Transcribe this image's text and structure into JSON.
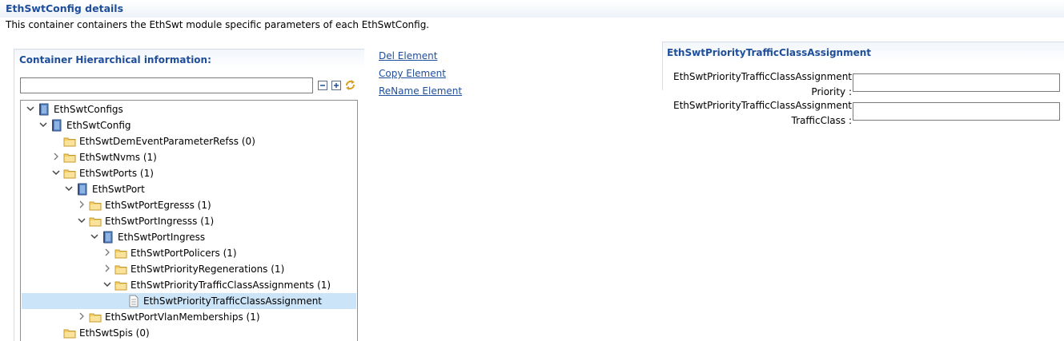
{
  "header": {
    "title": "EthSwtConfig details",
    "description": "This container containers the EthSwt module specific parameters of each EthSwtConfig."
  },
  "left_panel": {
    "title": "Container Hierarchical information:",
    "filter_value": ""
  },
  "actions": {
    "del": "Del Element",
    "copy": "Copy Element",
    "rename": "ReName Element"
  },
  "tree": [
    {
      "label": "EthSwtConfigs",
      "twisty": "expanded",
      "icon": "module"
    },
    {
      "label": "EthSwtConfig",
      "twisty": "expanded",
      "icon": "module"
    },
    {
      "label": "EthSwtDemEventParameterRefss (0)",
      "twisty": "none",
      "icon": "folder"
    },
    {
      "label": "EthSwtNvms (1)",
      "twisty": "collapsed",
      "icon": "folder"
    },
    {
      "label": "EthSwtPorts (1)",
      "twisty": "expanded",
      "icon": "folder"
    },
    {
      "label": "EthSwtPort",
      "twisty": "expanded",
      "icon": "module"
    },
    {
      "label": "EthSwtPortEgresss (1)",
      "twisty": "collapsed",
      "icon": "folder"
    },
    {
      "label": "EthSwtPortIngresss (1)",
      "twisty": "expanded",
      "icon": "folder"
    },
    {
      "label": "EthSwtPortIngress",
      "twisty": "expanded",
      "icon": "module"
    },
    {
      "label": "EthSwtPortPolicers (1)",
      "twisty": "collapsed",
      "icon": "folder"
    },
    {
      "label": "EthSwtPriorityRegenerations (1)",
      "twisty": "collapsed",
      "icon": "folder"
    },
    {
      "label": "EthSwtPriorityTrafficClassAssignments (1)",
      "twisty": "expanded",
      "icon": "folder"
    },
    {
      "label": "EthSwtPriorityTrafficClassAssignment",
      "twisty": "none",
      "icon": "document",
      "selected": true
    },
    {
      "label": "EthSwtPortVlanMemberships (1)",
      "twisty": "collapsed",
      "icon": "folder"
    },
    {
      "label": "EthSwtSpis (0)",
      "twisty": "none",
      "icon": "folder"
    }
  ],
  "right_panel": {
    "title": "EthSwtPriorityTrafficClassAssignment",
    "fields": [
      {
        "label": "EthSwtPriorityTrafficClassAssignmentPriority :",
        "value": ""
      },
      {
        "label": "EthSwtPriorityTrafficClassAssignmentTrafficClass :",
        "value": ""
      }
    ]
  }
}
